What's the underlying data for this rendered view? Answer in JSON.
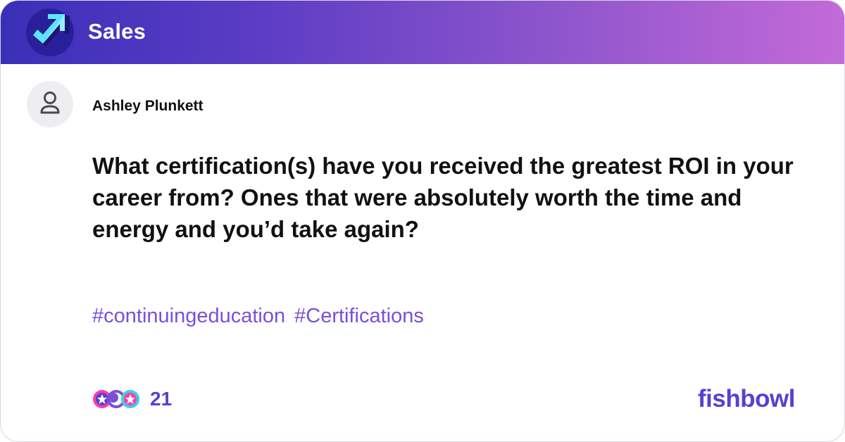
{
  "header": {
    "bowl_name": "Sales",
    "logo_icon": "trending-up-arrow-icon",
    "gradient": [
      "#3a2fb8",
      "#c46ad8"
    ]
  },
  "post": {
    "author_name": "Ashley Plunkett",
    "avatar_icon": "user-icon",
    "question": "What certification(s) have you received the greatest ROI in your career from? Ones that were absolutely worth the time and energy and you’d take again?",
    "tags": [
      "#continuingeducation",
      "#Certifications"
    ]
  },
  "footer": {
    "reaction_count": "21",
    "reaction_icons": [
      "star-icon",
      "moon-icon",
      "star-icon"
    ],
    "brand": "fishbowl"
  },
  "colors": {
    "accent": "#5a3fd0",
    "tag": "#7b4fd6",
    "text": "#111111"
  }
}
